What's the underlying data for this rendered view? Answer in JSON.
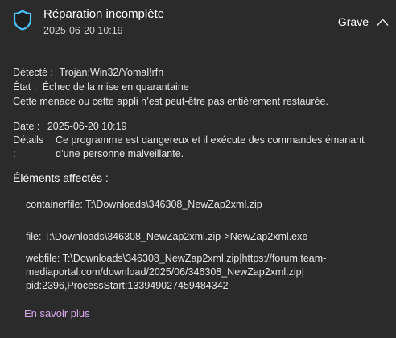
{
  "header": {
    "title": "Réparation incomplète",
    "date": "2025-06-20 10:19",
    "severity": "Grave",
    "shield_icon": "shield-icon",
    "collapse_icon": "chevron-up-icon",
    "accent_color": "#4cc2ff"
  },
  "summary": {
    "detected_label": "Détecté :",
    "detected_value": "Trojan:Win32/Yomal!rfn",
    "status_label": "État :",
    "status_value": "Échec de la mise en quarantaine",
    "note": "Cette menace ou cette appli n’est peut-être pas entièrement restaurée.",
    "date_label": "Date :",
    "date_value": "2025-06-20 10:19",
    "details_label": "Détails :",
    "details_value": "Ce programme est dangereux et il exécute des commandes émanant d’une personne malveillante."
  },
  "affected": {
    "title": "Éléments affectés :",
    "items": [
      "containerfile: T:\\Downloads\\346308_NewZap2xml.zip",
      "file: T:\\Downloads\\346308_NewZap2xml.zip->NewZap2xml.exe",
      "webfile: T:\\Downloads\\346308_NewZap2xml.zip|https://forum.team-mediaportal.com/download/2025/06/346308_NewZap2xml.zip|pid:2396,ProcessStart:133949027459484342"
    ]
  },
  "learn_more": "En savoir plus",
  "colors": {
    "background": "#2b2b2b",
    "link": "#d8a9f0"
  }
}
